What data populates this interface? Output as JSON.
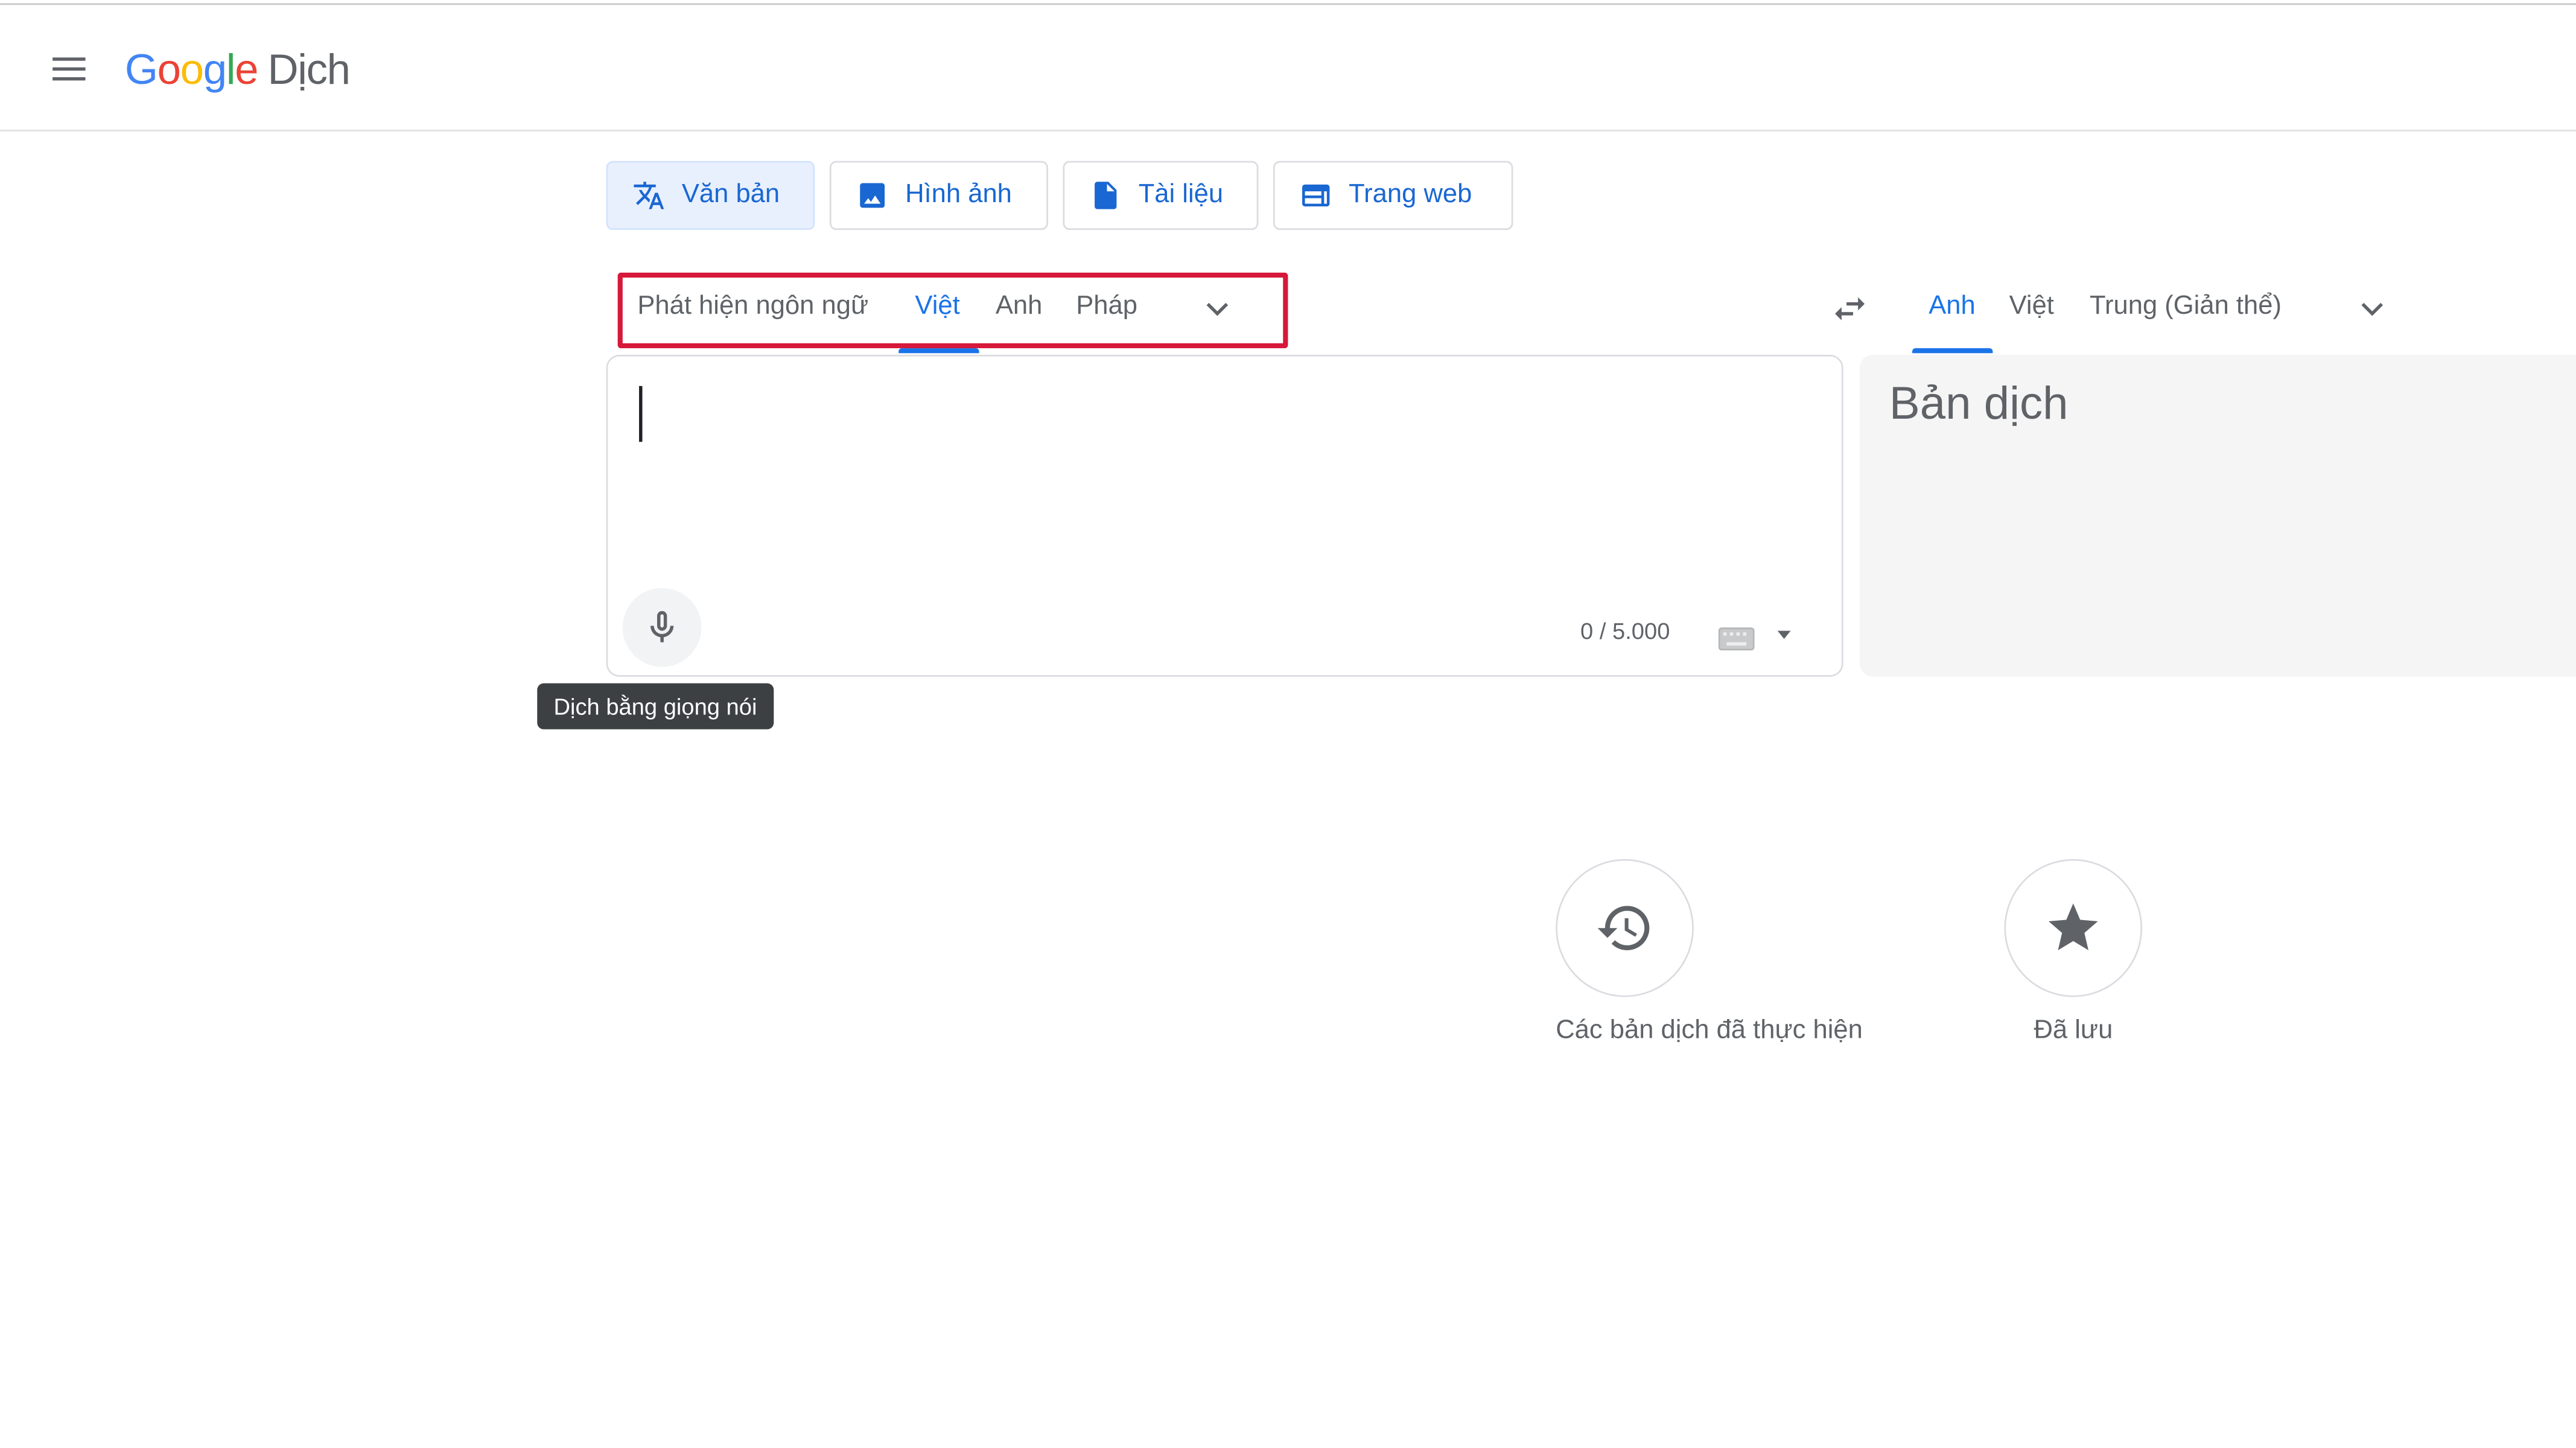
{
  "header": {
    "logo_letters": [
      "G",
      "o",
      "o",
      "g",
      "l",
      "e"
    ],
    "product": "Dịch",
    "icons": {
      "menu": "menu-icon"
    }
  },
  "modes": [
    {
      "label": "Văn bản",
      "icon": "translate-icon",
      "active": true
    },
    {
      "label": "Hình ảnh",
      "icon": "image-icon",
      "active": false
    },
    {
      "label": "Tài liệu",
      "icon": "document-icon",
      "active": false
    },
    {
      "label": "Trang web",
      "icon": "web-icon",
      "active": false
    }
  ],
  "source_langs": {
    "detect": "Phát hiện ngôn ngữ",
    "items": [
      "Việt",
      "Anh",
      "Pháp"
    ],
    "selected": "Việt"
  },
  "target_langs": {
    "items": [
      "Anh",
      "Việt",
      "Trung (Giản thể)"
    ],
    "selected": "Anh"
  },
  "source": {
    "text": "",
    "counter": "0 / 5.000",
    "mic_tooltip": "Dịch bằng giọng nói"
  },
  "target": {
    "placeholder": "Bản dịch"
  },
  "bottom": {
    "history_label": "Các bản dịch đã thực hiện",
    "saved_label": "Đã lưu"
  },
  "colors": {
    "accent": "#1a73e8",
    "highlight_box": "#d6183a",
    "tab_active_bg": "#e8f0fe",
    "target_bg": "#f5f5f5"
  }
}
